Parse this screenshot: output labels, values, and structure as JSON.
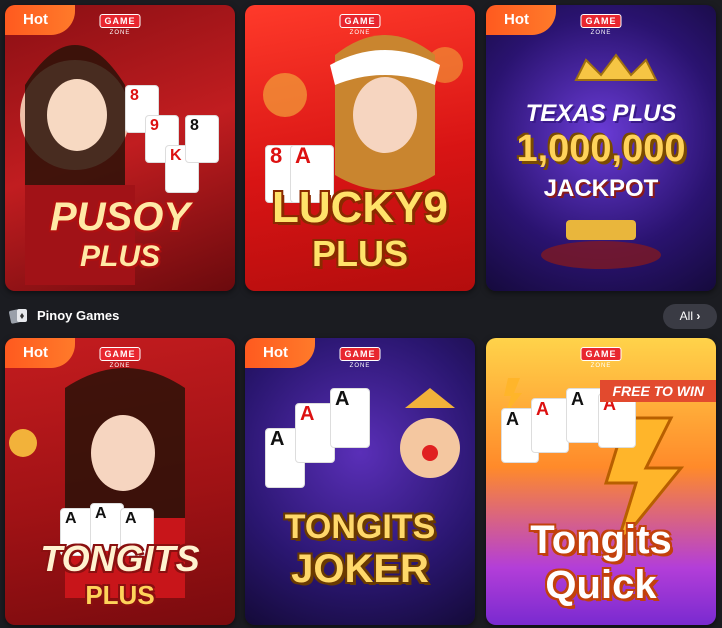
{
  "hot_label": "Hot",
  "gamezone": {
    "top": "GAME",
    "sub": "ZONE"
  },
  "section": {
    "title": "Pinoy Games",
    "all_label": "All"
  },
  "games": [
    {
      "title_line1": "PUSOY",
      "title_line2": "PLUS",
      "hot": true
    },
    {
      "title_line1": "LUCKY9",
      "title_line2": "PLUS",
      "hot": false
    },
    {
      "title_line1": "TEXAS PLUS",
      "title_line2": "1,000,000",
      "title_line3": "JACKPOT",
      "hot": true
    },
    {
      "title_line1": "TONGITS",
      "title_line2": "PLUS",
      "hot": true
    },
    {
      "title_line1": "TONGITS",
      "title_line2": "JOKER",
      "hot": true
    },
    {
      "title_line1": "Tongits",
      "title_line2": "Quick",
      "badge": "FREE TO WIN",
      "hot": false
    }
  ],
  "colors": {
    "background": "#1b1c21",
    "hot": "#ff5a1f",
    "all_button": "#3a3b44"
  }
}
